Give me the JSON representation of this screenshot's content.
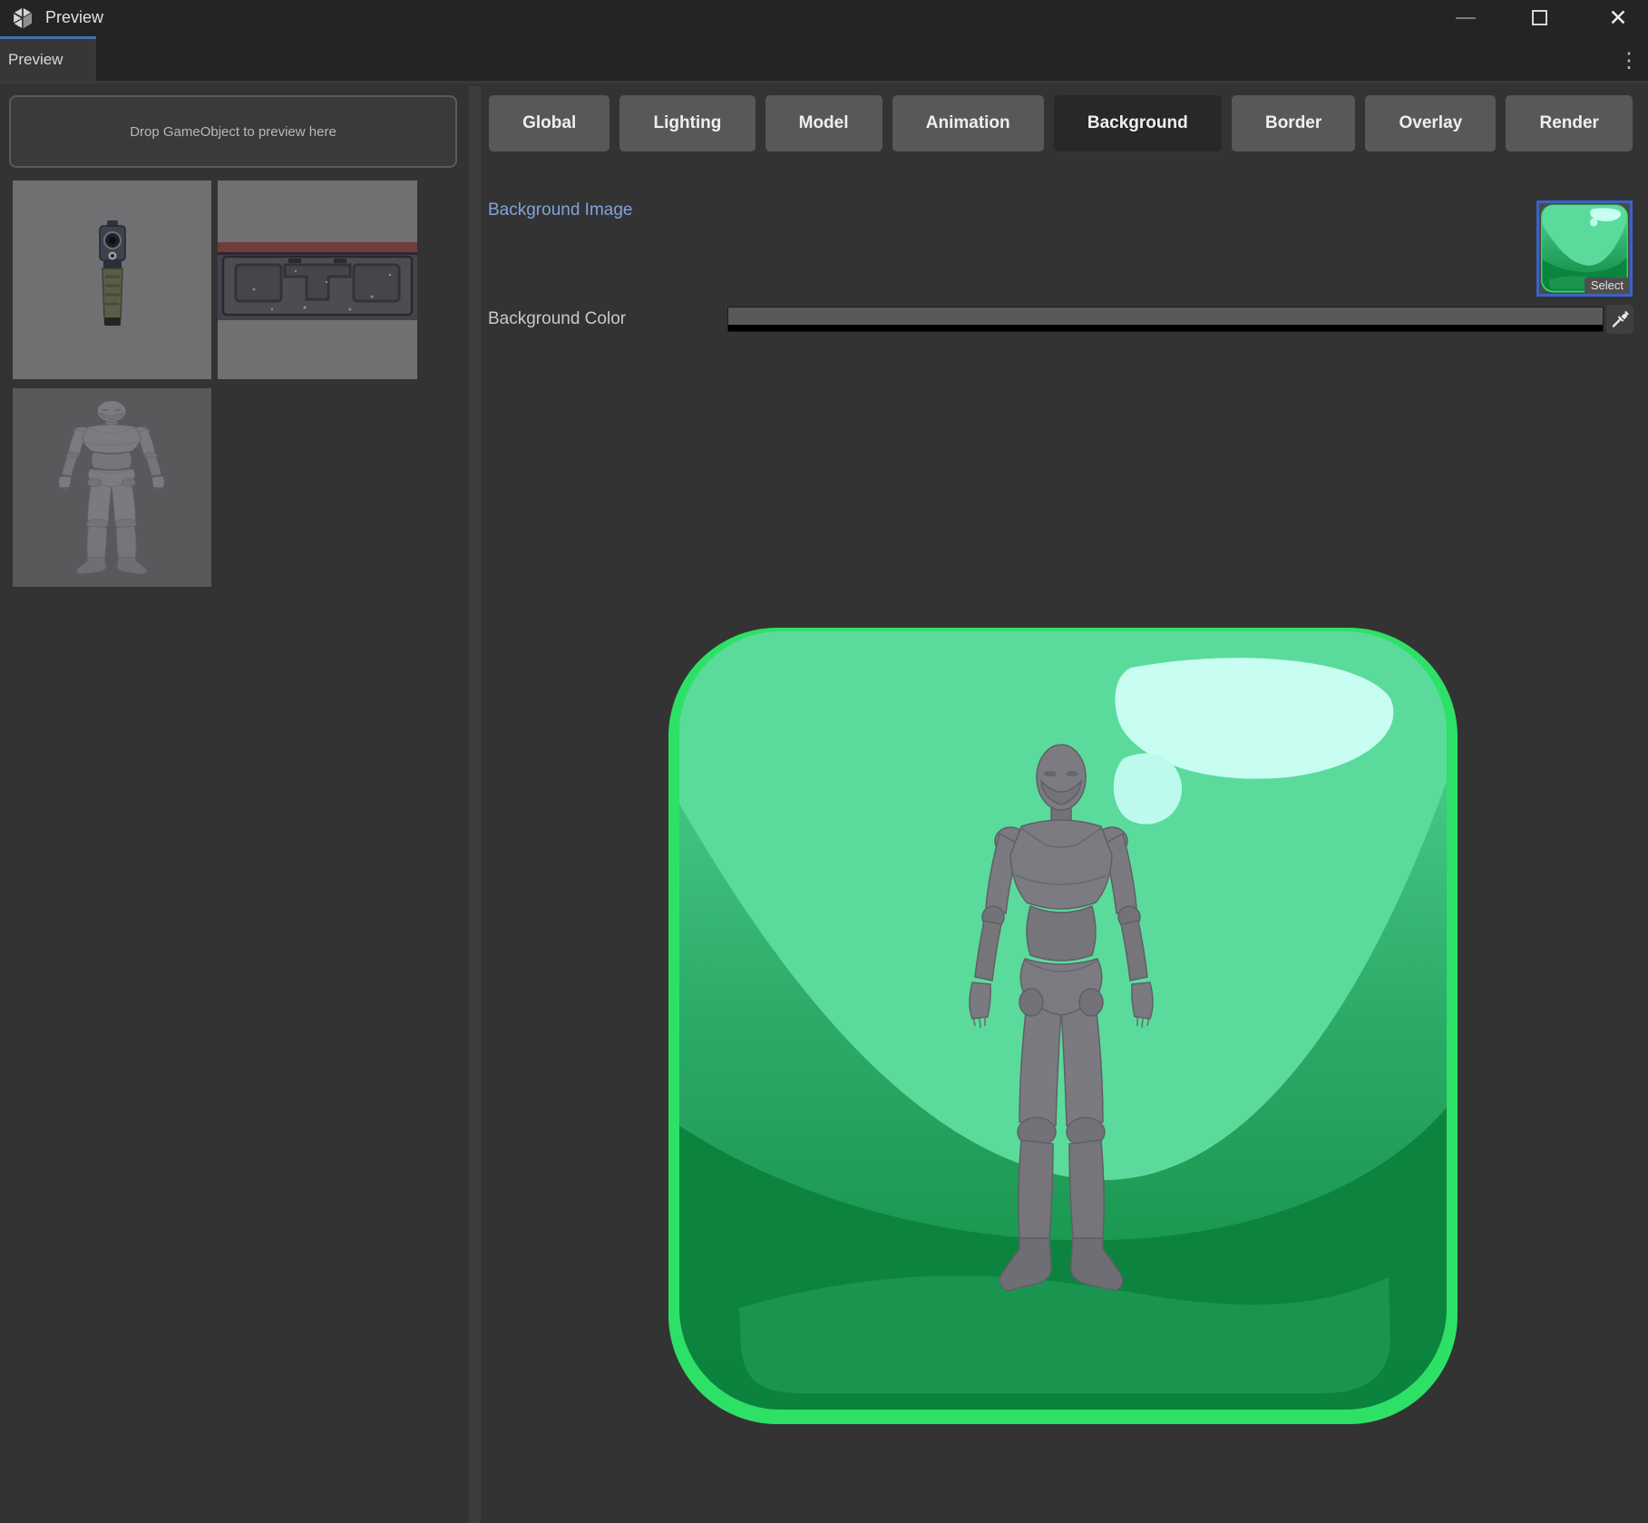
{
  "window": {
    "title": "Preview",
    "tab_label": "Preview",
    "menu_icon": "⋮",
    "close_icon": "✕"
  },
  "left_panel": {
    "drop_zone_label": "Drop GameObject to preview here",
    "thumbnails": [
      {
        "name": "pistol-preview"
      },
      {
        "name": "metal-crate-preview"
      },
      {
        "name": "mannequin-preview"
      }
    ]
  },
  "toolbar": {
    "buttons": [
      {
        "label": "Global",
        "active": false
      },
      {
        "label": "Lighting",
        "active": false
      },
      {
        "label": "Model",
        "active": false
      },
      {
        "label": "Animation",
        "active": false
      },
      {
        "label": "Background",
        "active": true
      },
      {
        "label": "Border",
        "active": false
      },
      {
        "label": "Overlay",
        "active": false
      },
      {
        "label": "Render",
        "active": false
      }
    ]
  },
  "background_section": {
    "image_label": "Background Image",
    "select_label": "Select",
    "color_label": "Background Color"
  },
  "preview": {
    "subject": "mannequin",
    "background_image": "green-glossy-button"
  },
  "colors": {
    "accent_tab": "#3e76ad",
    "selection_blue": "#3b63c5",
    "label_blue": "#7fa3dc",
    "green_light": "#58d998",
    "green_dark": "#0e8a41",
    "green_rim": "#2de167",
    "highlight": "#c8fdf2",
    "swatch": "#59595a",
    "alpha_bar": "#000000"
  }
}
